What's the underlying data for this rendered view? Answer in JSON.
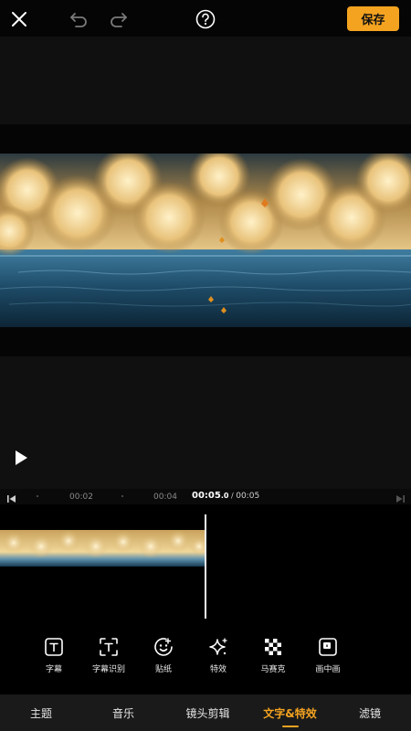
{
  "toolbar": {
    "save_label": "保存",
    "icons": [
      "close-icon",
      "undo-icon",
      "redo-icon",
      "help-icon"
    ]
  },
  "timeline": {
    "tick_labels": [
      "00:02",
      "00:04"
    ],
    "current_time": "00:05",
    "current_fraction": ".0",
    "separator": " / ",
    "total_time": "00:05"
  },
  "tools": [
    {
      "label": "字幕",
      "icon": "subtitle-icon"
    },
    {
      "label": "字幕识别",
      "icon": "subtitle-recognition-icon"
    },
    {
      "label": "贴纸",
      "icon": "sticker-icon"
    },
    {
      "label": "特效",
      "icon": "effects-sparkle-icon"
    },
    {
      "label": "马赛克",
      "icon": "mosaic-icon"
    },
    {
      "label": "画中画",
      "icon": "picture-in-picture-icon"
    }
  ],
  "tabs": [
    {
      "label": "主题",
      "active": false
    },
    {
      "label": "音乐",
      "active": false
    },
    {
      "label": "镜头剪辑",
      "active": false
    },
    {
      "label": "文字&特效",
      "active": true
    },
    {
      "label": "滤镜",
      "active": false
    }
  ],
  "colors": {
    "accent": "#f4a320",
    "background": "#000000",
    "tab_bar": "#1a1a1a"
  }
}
